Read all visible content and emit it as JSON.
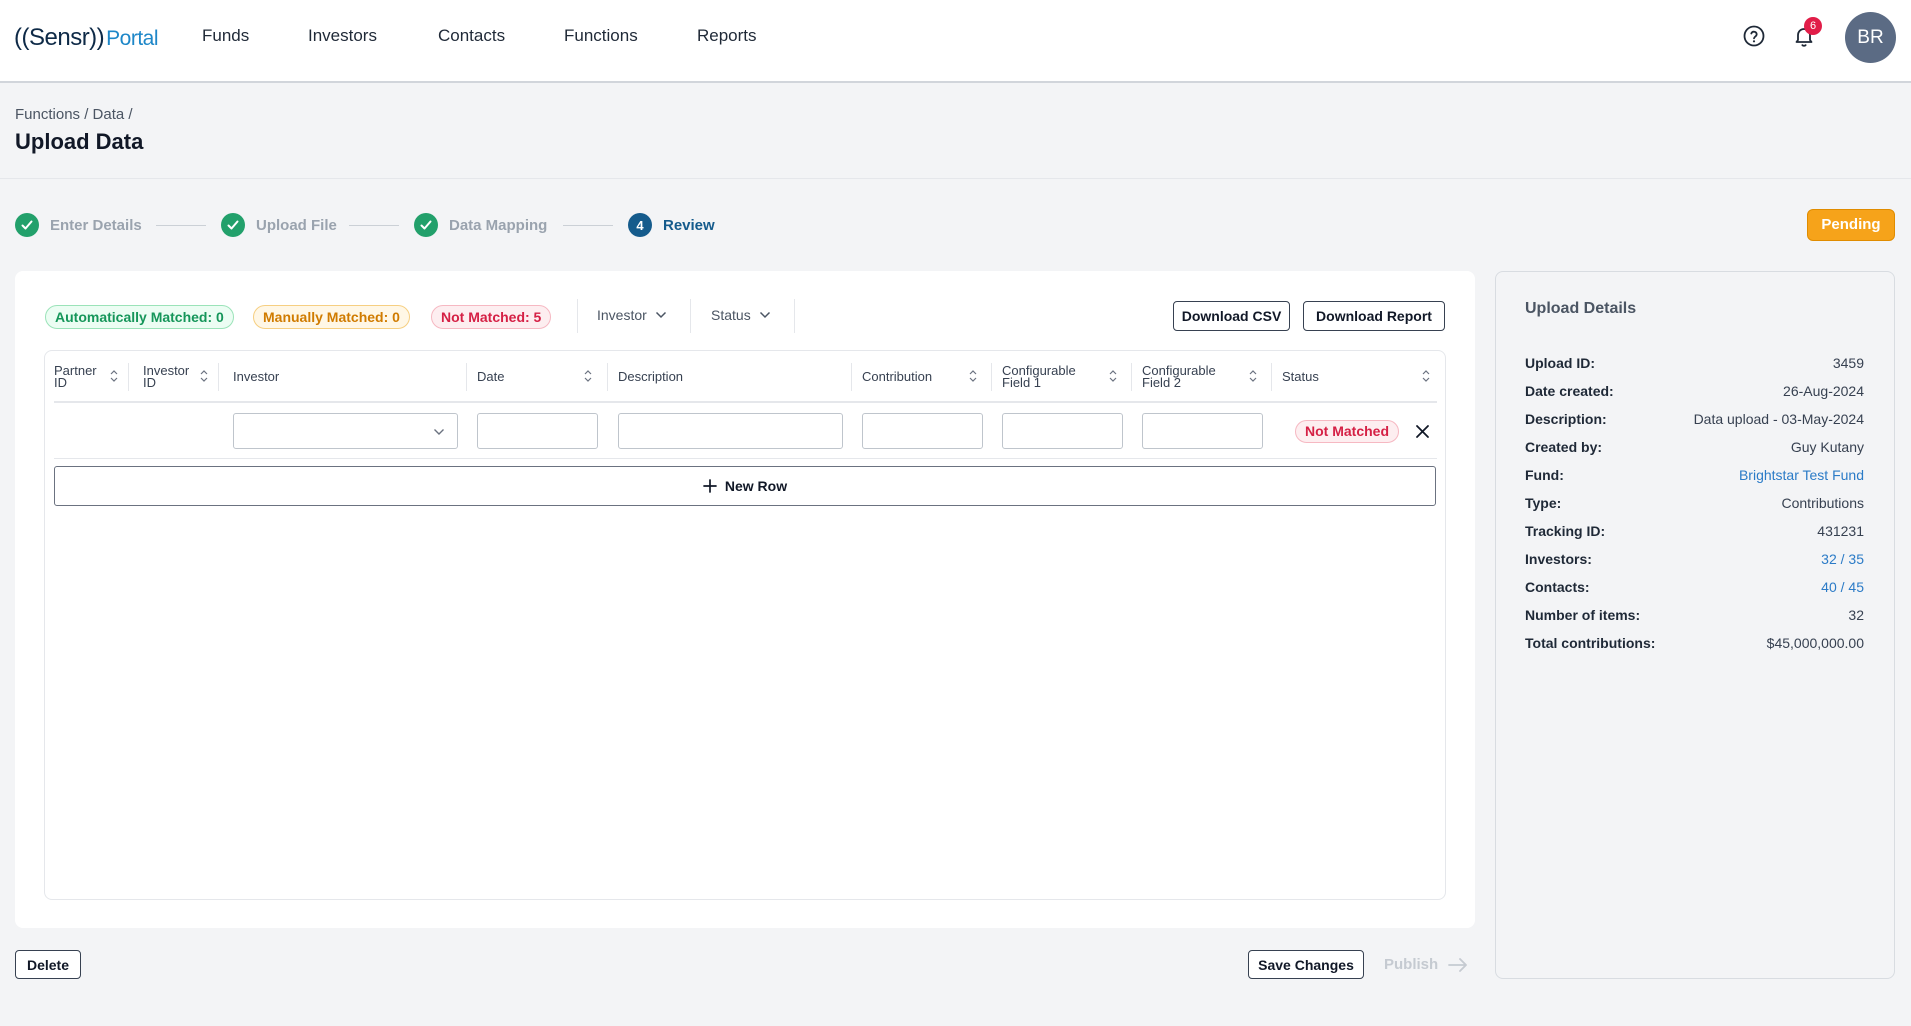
{
  "app": {
    "logo_brand": "((Sensr))",
    "logo_portal": "Portal"
  },
  "nav": {
    "items": [
      "Funds",
      "Investors",
      "Contacts",
      "Functions",
      "Reports"
    ],
    "notification_count": "6",
    "avatar_initials": "BR",
    "icons": [
      "help-icon",
      "bell-icon"
    ]
  },
  "header": {
    "breadcrumb": "Functions / Data /",
    "title": "Upload Data"
  },
  "stepper": {
    "steps": [
      {
        "label": "Enter Details",
        "state": "done"
      },
      {
        "label": "Upload File",
        "state": "done"
      },
      {
        "label": "Data Mapping",
        "state": "done"
      },
      {
        "label": "Review",
        "state": "active",
        "number": "4"
      }
    ],
    "status_badge": "Pending"
  },
  "summary": {
    "auto_matched": "Automatically Matched: 0",
    "manual_matched": "Manually Matched: 0",
    "not_matched": "Not Matched: 5",
    "filter_investor": "Investor",
    "filter_status": "Status",
    "download_csv": "Download CSV",
    "download_report": "Download Report"
  },
  "table": {
    "columns": [
      {
        "line1": "Partner",
        "line2": "ID"
      },
      {
        "line1": "Investor",
        "line2": "ID"
      },
      {
        "line1": "Investor",
        "line2": ""
      },
      {
        "line1": "Date",
        "line2": ""
      },
      {
        "line1": "Description",
        "line2": ""
      },
      {
        "line1": "Contribution",
        "line2": ""
      },
      {
        "line1": "Configurable",
        "line2": "Field 1"
      },
      {
        "line1": "Configurable",
        "line2": "Field 2"
      },
      {
        "line1": "Status",
        "line2": ""
      }
    ],
    "row": {
      "investor": "",
      "date": "",
      "description": "",
      "contribution": "",
      "field1": "",
      "field2": "",
      "status": "Not Matched"
    },
    "new_row_label": "New Row"
  },
  "actions": {
    "delete": "Delete",
    "save": "Save Changes",
    "publish": "Publish"
  },
  "upload_details": {
    "title": "Upload Details",
    "rows": [
      {
        "label": "Upload ID:",
        "value": "3459",
        "link": false
      },
      {
        "label": "Date created:",
        "value": "26-Aug-2024",
        "link": false
      },
      {
        "label": "Description:",
        "value": "Data upload - 03-May-2024",
        "link": false
      },
      {
        "label": "Created by:",
        "value": "Guy Kutany",
        "link": false
      },
      {
        "label": "Fund:",
        "value": "Brightstar Test Fund",
        "link": true
      },
      {
        "label": "Type:",
        "value": "Contributions",
        "link": false
      },
      {
        "label": "Tracking ID:",
        "value": "431231",
        "link": false
      },
      {
        "label": "Investors:",
        "value": "32 / 35",
        "link": true
      },
      {
        "label": "Contacts:",
        "value": "40 / 45",
        "link": true
      },
      {
        "label": "Number of items:",
        "value": "32",
        "link": false
      },
      {
        "label": "Total contributions:",
        "value": "$45,000,000.00",
        "link": false
      }
    ]
  },
  "colors": {
    "success": "#22a06b",
    "active_step": "#155b8c",
    "pending": "#f6a31a",
    "link": "#2b7bc7"
  }
}
